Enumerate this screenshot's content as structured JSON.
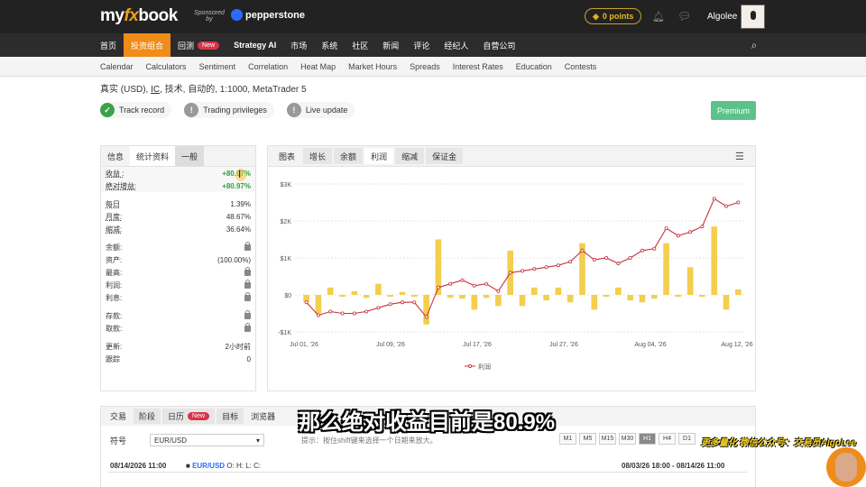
{
  "header": {
    "logo_prefix": "my",
    "logo_fx": "fx",
    "logo_suffix": "book",
    "sponsored_line1": "Sponsored",
    "sponsored_line2": "by",
    "sponsor_name": "pepperstone",
    "points": "0 points",
    "username": "Algolee"
  },
  "nav": {
    "items": [
      {
        "label": "首页"
      },
      {
        "label": "投资组合"
      },
      {
        "label": "回测",
        "badge": "New"
      },
      {
        "label": "Strategy AI"
      },
      {
        "label": "市场"
      },
      {
        "label": "系统"
      },
      {
        "label": "社区"
      },
      {
        "label": "新闻"
      },
      {
        "label": "评论"
      },
      {
        "label": "经纪人"
      },
      {
        "label": "自营公司"
      }
    ]
  },
  "subnav": [
    "Calendar",
    "Calculators",
    "Sentiment",
    "Correlation",
    "Heat Map",
    "Market Hours",
    "Spreads",
    "Interest Rates",
    "Education",
    "Contests"
  ],
  "account": {
    "desc_prefix": "真实 (USD), ",
    "desc_broker": "IC",
    "desc_suffix": ", 技术, 自动的, 1:1000, MetaTrader 5",
    "badges": [
      "Track record",
      "Trading privileges",
      "Live update"
    ],
    "premium": "Premium"
  },
  "stats": {
    "tabs": [
      "信息",
      "统计资料",
      "一般"
    ],
    "rows": [
      {
        "label": "收益 :",
        "value": "+80.97%",
        "green": true,
        "hl": true
      },
      {
        "label": "绝对增益:",
        "value": "+80.97%",
        "green": true,
        "hl": true
      },
      {
        "label": "每日",
        "value": "1.39%"
      },
      {
        "label": "月度:",
        "value": "48.67%"
      },
      {
        "label": "缩减:",
        "value": "36.64%"
      },
      {
        "label": "余额:",
        "value": ""
      },
      {
        "label": "资产:",
        "value": "(100.00%)"
      },
      {
        "label": "最高:",
        "value": ""
      },
      {
        "label": "利润:",
        "value": ""
      },
      {
        "label": "利息:",
        "value": ""
      },
      {
        "label": "存款:",
        "value": ""
      },
      {
        "label": "取款:",
        "value": ""
      },
      {
        "label": "更新:",
        "value": "2小时前"
      },
      {
        "label": "跟踪",
        "value": "0"
      }
    ]
  },
  "chart_tabs": [
    "图表",
    "增长",
    "余额",
    "利润",
    "缩减",
    "保证金"
  ],
  "chart_data": {
    "type": "bar",
    "title": "",
    "yticks": [
      "$3K",
      "$2K",
      "$1K",
      "$0",
      "-$1K"
    ],
    "ylim": [
      -1000,
      3000
    ],
    "xticks": [
      "Jul 01, '26",
      "Jul 09, '26",
      "Jul 17, '26",
      "Jul 27, '26",
      "Aug 04, '26",
      "Aug 12, '26"
    ],
    "legend": "利润",
    "bars": [
      -200,
      -500,
      200,
      -50,
      100,
      -80,
      300,
      -50,
      80,
      -50,
      -800,
      1500,
      -80,
      -100,
      -400,
      -80,
      -300,
      1200,
      -300,
      200,
      -150,
      200,
      -200,
      1400,
      -400,
      -50,
      200,
      -150,
      -200,
      -100,
      1400,
      -50,
      750,
      -50,
      1850,
      -400,
      150
    ],
    "line": [
      -200,
      -550,
      -450,
      -500,
      -500,
      -450,
      -350,
      -250,
      -200,
      -200,
      -600,
      200,
      300,
      400,
      250,
      300,
      100,
      600,
      650,
      700,
      750,
      800,
      900,
      1200,
      950,
      1000,
      850,
      1000,
      1200,
      1250,
      1800,
      1600,
      1700,
      1850,
      2600,
      2400,
      2500
    ]
  },
  "bottom": {
    "tabs": [
      {
        "label": "交易"
      },
      {
        "label": "阶段"
      },
      {
        "label": "日历",
        "badge": "New"
      },
      {
        "label": "目标"
      },
      {
        "label": "浏览器"
      }
    ],
    "symbol_label": "符号",
    "symbol_value": "EUR/USD",
    "hint": "提示：按住shift键来选择一个日期来放大。",
    "timeframes": [
      "M1",
      "M5",
      "M15",
      "M30",
      "H1",
      "H4",
      "D1"
    ],
    "mini_left_date": "08/14/2026 11:00",
    "mini_symbol": "EUR/USD",
    "mini_ohlc": "O: H: L: C:",
    "mini_range": "08/03/26 18:00 - 08/14/26 11:00"
  },
  "overlay": {
    "caption": "那么绝对收益目前是80.9%",
    "watermark": "更多量化 微信公众号：交易员AlgoLee"
  },
  "colors": {
    "accent": "#ef8c1a",
    "bar": "#f2cf4d",
    "line": "#c8323c",
    "green": "#2ea043"
  }
}
